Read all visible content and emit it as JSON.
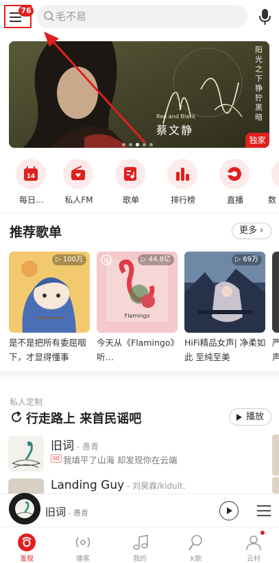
{
  "colors": {
    "accent": "#e0201d",
    "annotation": "#e0201d"
  },
  "menu": {
    "badge": "76"
  },
  "search": {
    "placeholder": "毛不易"
  },
  "banner": {
    "subtitle": "Red and Black",
    "artist": "蔡文静",
    "vertical_text": "阳光之下 狰狞黑暗",
    "badge": "独家"
  },
  "quick_entries": [
    {
      "label": "每日…",
      "icon": "calendar-icon",
      "day": "14"
    },
    {
      "label": "私人FM",
      "icon": "radio-icon"
    },
    {
      "label": "歌单",
      "icon": "playlist-icon"
    },
    {
      "label": "排行榜",
      "icon": "chart-icon"
    },
    {
      "label": "直播",
      "icon": "live-icon"
    },
    {
      "label": "数",
      "icon": "more-icon"
    }
  ],
  "playlists_section": {
    "title": "推荐歌单",
    "more": "更多"
  },
  "playlists": [
    {
      "title": "是不是把所有委屈咽下，才显得懂事",
      "count": "100万"
    },
    {
      "title": "今天从《Flamingo》听…",
      "count": "44.8亿",
      "cover_text": "Flamingo"
    },
    {
      "title": "HiFi精品女声| 净柔如此 至纯至美",
      "count": "69万"
    },
    {
      "title": "严声",
      "count": ""
    }
  ],
  "personal": {
    "label": "私人定制",
    "title": "行走路上 来首民谣吧",
    "play": "播放"
  },
  "songs": [
    {
      "title": "旧词",
      "artist": " - 愚青",
      "quality": "SQ",
      "desc": "我填平了山海 却发现你在云端"
    },
    {
      "title": "Landing Guy",
      "artist": " - 刘昊霖/kidult.",
      "quality": "",
      "desc": ""
    }
  ],
  "mini_player": {
    "title": "旧词",
    "artist": " - 愚青"
  },
  "nav": [
    {
      "label": "发现",
      "icon": "discover-icon",
      "active": true
    },
    {
      "label": "播客",
      "icon": "podcast-icon",
      "active": false
    },
    {
      "label": "我的",
      "icon": "music-note-icon",
      "active": false
    },
    {
      "label": "K歌",
      "icon": "karaoke-icon",
      "active": false
    },
    {
      "label": "云村",
      "icon": "community-icon",
      "active": false
    }
  ]
}
